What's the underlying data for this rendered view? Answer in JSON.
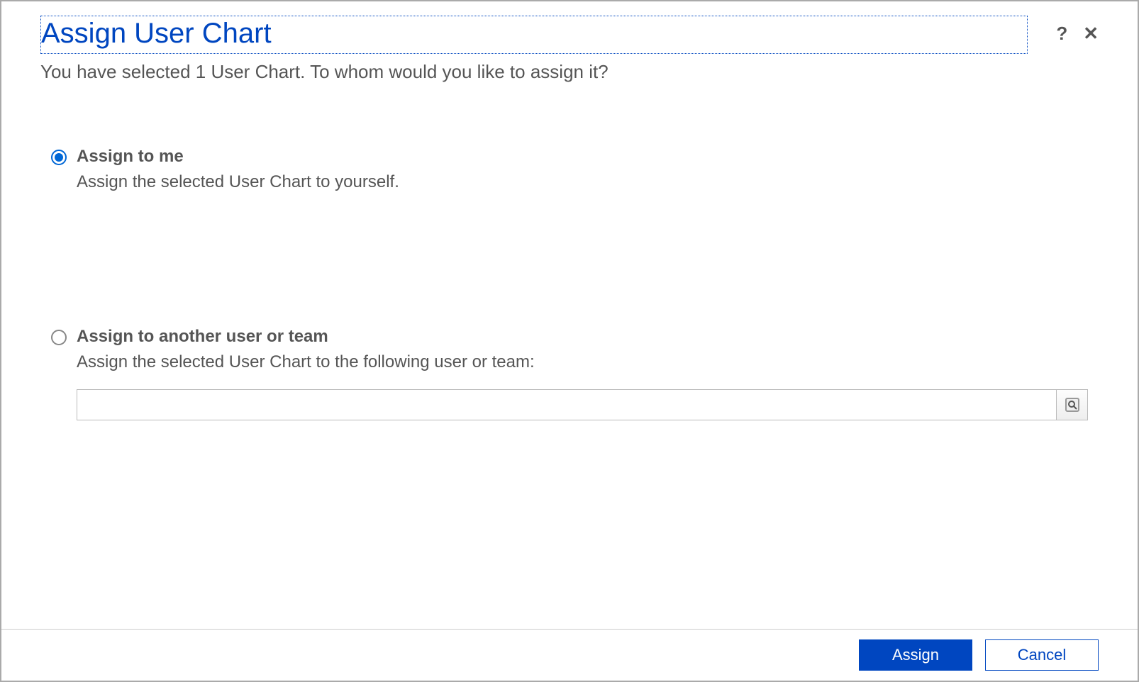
{
  "dialog": {
    "title": "Assign User Chart",
    "subtitle": "You have selected 1 User Chart. To whom would you like to assign it?"
  },
  "options": {
    "me": {
      "title": "Assign to me",
      "desc": "Assign the selected User Chart to yourself.",
      "selected": true
    },
    "other": {
      "title": "Assign to another user or team",
      "desc": "Assign the selected User Chart to the following user or team:",
      "selected": false,
      "lookup_value": ""
    }
  },
  "footer": {
    "assign": "Assign",
    "cancel": "Cancel"
  },
  "icons": {
    "help": "?",
    "close": "✕"
  }
}
